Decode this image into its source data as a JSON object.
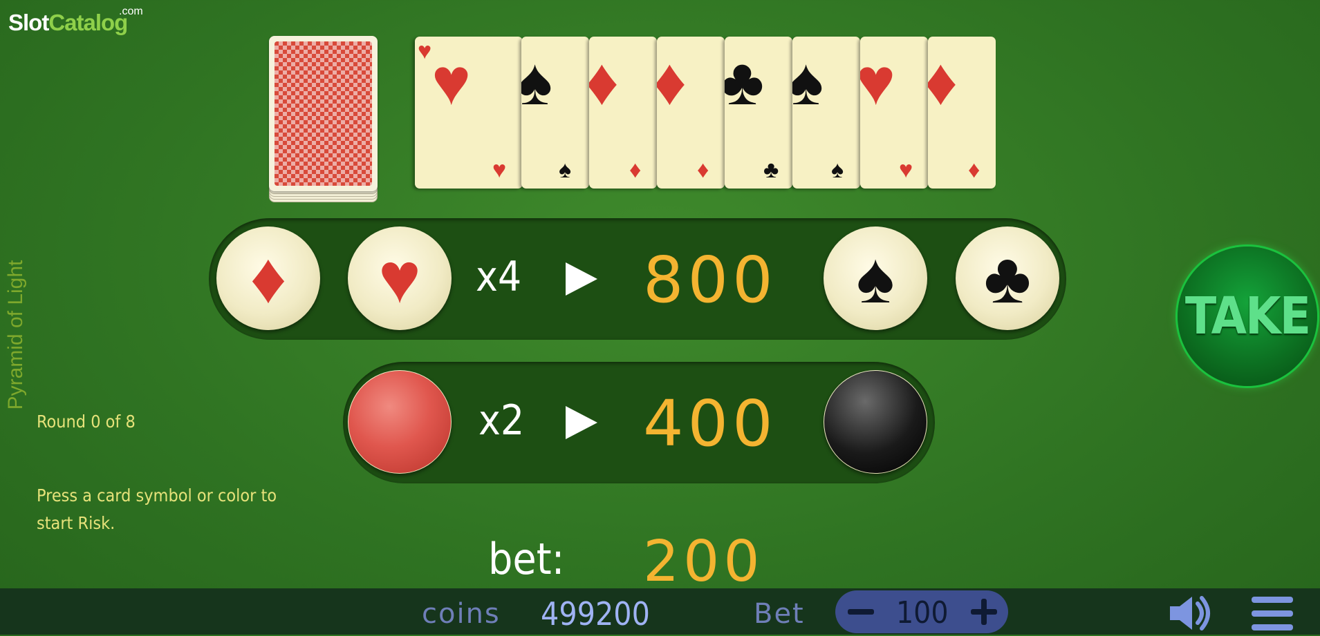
{
  "logo": {
    "text_slot": "Slot",
    "text_catalog": "Catalog",
    "sup": ".com"
  },
  "game_title": "Pyramid of Light",
  "history_cards": [
    {
      "suit": "heart",
      "glyph": "♥",
      "color": "#d93a31"
    },
    {
      "suit": "spade",
      "glyph": "♠",
      "color": "#111111"
    },
    {
      "suit": "diamond",
      "glyph": "♦",
      "color": "#d93a31"
    },
    {
      "suit": "diamond",
      "glyph": "♦",
      "color": "#d93a31"
    },
    {
      "suit": "club",
      "glyph": "♣",
      "color": "#111111"
    },
    {
      "suit": "spade",
      "glyph": "♠",
      "color": "#111111"
    },
    {
      "suit": "heart",
      "glyph": "♥",
      "color": "#d93a31"
    },
    {
      "suit": "diamond",
      "glyph": "♦",
      "color": "#d93a31"
    }
  ],
  "suit_row": {
    "multiplier": "x4",
    "win": "800",
    "buttons": {
      "diamond": "♦",
      "heart": "♥",
      "spade": "♠",
      "club": "♣"
    }
  },
  "color_row": {
    "multiplier": "x2",
    "win": "400",
    "colors": {
      "red": "#e0574e",
      "black": "#1a1a1a"
    }
  },
  "round": {
    "text": "Round 0  of 8"
  },
  "hint": {
    "line1": "Press a card symbol or color to",
    "line2": "start Risk."
  },
  "bet": {
    "label": "bet:",
    "value": "200"
  },
  "take_label": "TAKE",
  "bottom": {
    "coins_label": "coins",
    "coins_value": "499200",
    "bet_label": "Bet",
    "bet_value": "100"
  },
  "colors": {
    "accent_gold": "#f4b431",
    "take_green": "#0c6d20",
    "felt": "#2f7322"
  },
  "icons": {
    "sound": "speaker-icon",
    "menu": "hamburger-menu-icon"
  }
}
